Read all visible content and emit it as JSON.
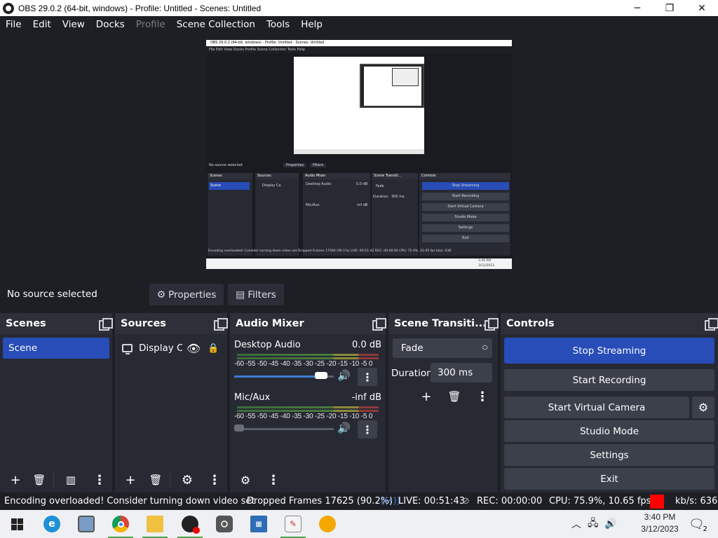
{
  "window": {
    "title": "OBS 29.0.2 (64-bit, windows) - Profile: Untitled - Scenes: Untitled",
    "minimize": "─",
    "maximize": "❐",
    "close": "✕"
  },
  "menu": [
    "File",
    "Edit",
    "View",
    "Docks",
    "Profile",
    "Scene Collection",
    "Tools",
    "Help"
  ],
  "preview": {
    "title": "OBS 29.0.2 (64-bit, windows) - Profile: Untitled - Scenes: Untitled",
    "menu": "File   Edit   View   Docks   Profile   Scene Collection   Tools   Help",
    "no_source": "No source selected",
    "properties": "Properties",
    "filters": "Filters",
    "scenes": "Scenes",
    "scene": "Scene",
    "sources": "Sources",
    "source_name": "Display Ca",
    "audio_mixer": "Audio Mixer",
    "desktop_audio": "Desktop Audio",
    "desktop_db": "0.0 dB",
    "mic": "Mic/Aux",
    "mic_db": "-inf dB",
    "transitions": "Scene Transiti...",
    "fade": "Fade",
    "duration": "Duration",
    "duration_value": "300 ms",
    "controls": "Controls",
    "stop_streaming": "Stop Streaming",
    "start_recording": "Start Recording",
    "start_virtual_camera": "Start Virtual Camera",
    "studio_mode": "Studio Mode",
    "settings": "Settings",
    "exit": "Exit",
    "status": "Encoding overloaded! Consider turning down video set   Dropped Frames 17566 (90.1%)   LIVE: 00:51:42   REC: 00:00:00   CPU: 75.9%, 10.65 fps   kb/s: 636",
    "clock_time": "3:40 PM",
    "clock_date": "3/12/2023"
  },
  "source_bar": {
    "label": "No source selected",
    "properties": "Properties",
    "filters": "Filters"
  },
  "scenes": {
    "title": "Scenes",
    "items": [
      "Scene"
    ]
  },
  "sources": {
    "title": "Sources",
    "items": [
      {
        "name": "Display Ca"
      }
    ]
  },
  "mixer": {
    "title": "Audio Mixer",
    "ticks": "-60 -55 -50 -45 -40 -35 -30 -25 -20 -15 -10  -5   0",
    "channels": [
      {
        "name": "Desktop Audio",
        "db": "0.0 dB",
        "volume": 0.88
      },
      {
        "name": "Mic/Aux",
        "db": "-inf dB",
        "volume": 0.0
      }
    ]
  },
  "transitions": {
    "title": "Scene Transiti...",
    "selected": "Fade",
    "duration_label": "Duration",
    "duration": "300 ms"
  },
  "controls": {
    "title": "Controls",
    "stop_streaming": "Stop Streaming",
    "start_recording": "Start Recording",
    "start_virtual_camera": "Start Virtual Camera",
    "studio_mode": "Studio Mode",
    "settings": "Settings",
    "exit": "Exit"
  },
  "status": {
    "message": "Encoding overloaded! Consider turning down video set",
    "dropped": "Dropped Frames 17625 (90.2%)",
    "live": "LIVE: 00:51:43",
    "rec": "REC: 00:00:00",
    "cpu": "CPU: 75.9%, 10.65 fps",
    "kbps": "kb/s: 636",
    "rec_color": "#ff0000"
  },
  "taskbar": {
    "icons": [
      "windows-start",
      "edge",
      "photos",
      "chrome",
      "file-explorer",
      "obs",
      "camera",
      "calculator",
      "notepad",
      "sticky"
    ],
    "time": "3:40 PM",
    "date": "3/12/2023",
    "notifications": "2"
  },
  "colors": {
    "accent": "#284cb8",
    "background": "#1e1f25",
    "dock": "#272a33"
  }
}
